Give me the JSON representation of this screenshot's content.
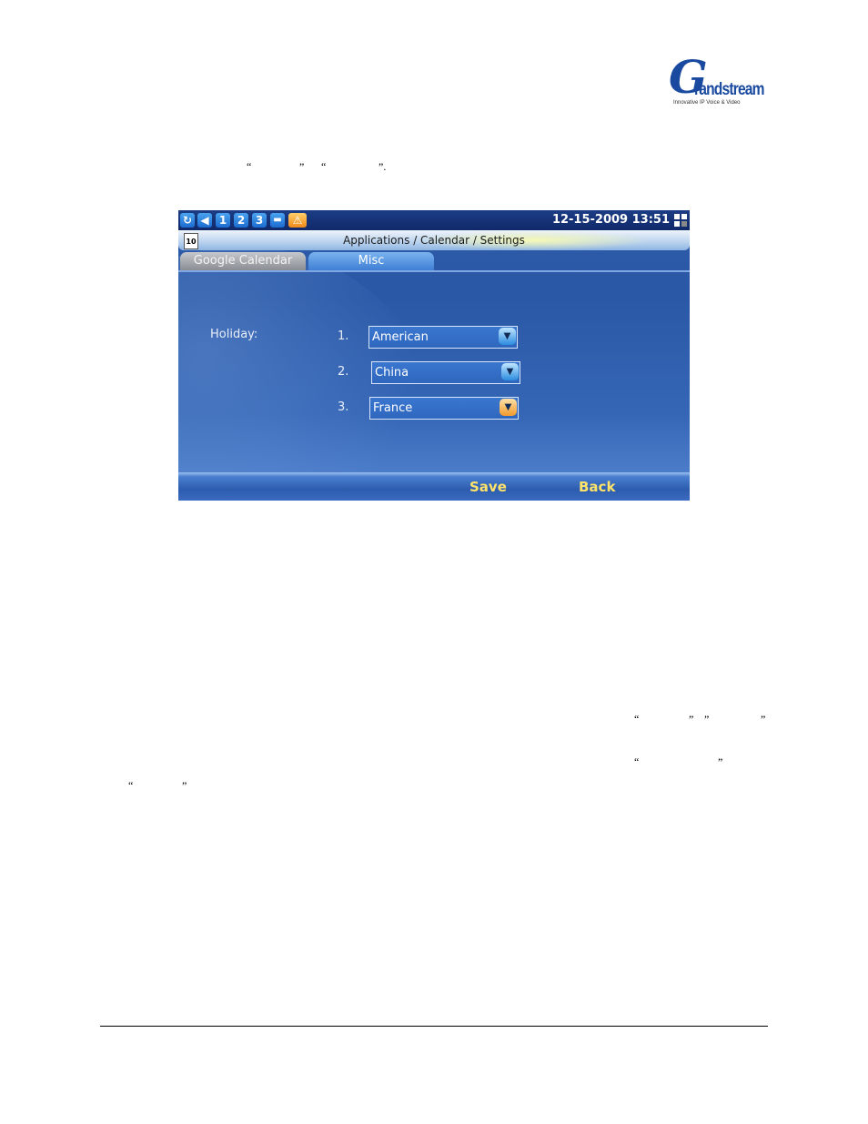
{
  "logo": {
    "initial": "G",
    "word": "randstream",
    "tagline": "Innovative IP Voice & Video"
  },
  "doc": {
    "quote_open": "“",
    "quote_close": "”",
    "quote_close_period": "”."
  },
  "device": {
    "status": {
      "icons": [
        "refresh-icon",
        "volume-icon",
        "line-1-icon",
        "line-2-icon",
        "line-3-icon",
        "tray-icon",
        "warning-icon"
      ],
      "line1": "1",
      "line2": "2",
      "line3": "3",
      "datetime": "12-15-2009 13:51"
    },
    "title": {
      "calendar_day": "10",
      "breadcrumb": "Applications / Calendar / Settings"
    },
    "tabs": [
      {
        "label": "Google Calendar",
        "selected": false
      },
      {
        "label": "Misc",
        "selected": true
      }
    ],
    "holiday": {
      "label": "Holiday:",
      "rows": [
        {
          "num": "1.",
          "value": "American"
        },
        {
          "num": "2.",
          "value": "China"
        },
        {
          "num": "3.",
          "value": "France"
        }
      ]
    },
    "softkeys": {
      "save": "Save",
      "back": "Back"
    }
  }
}
